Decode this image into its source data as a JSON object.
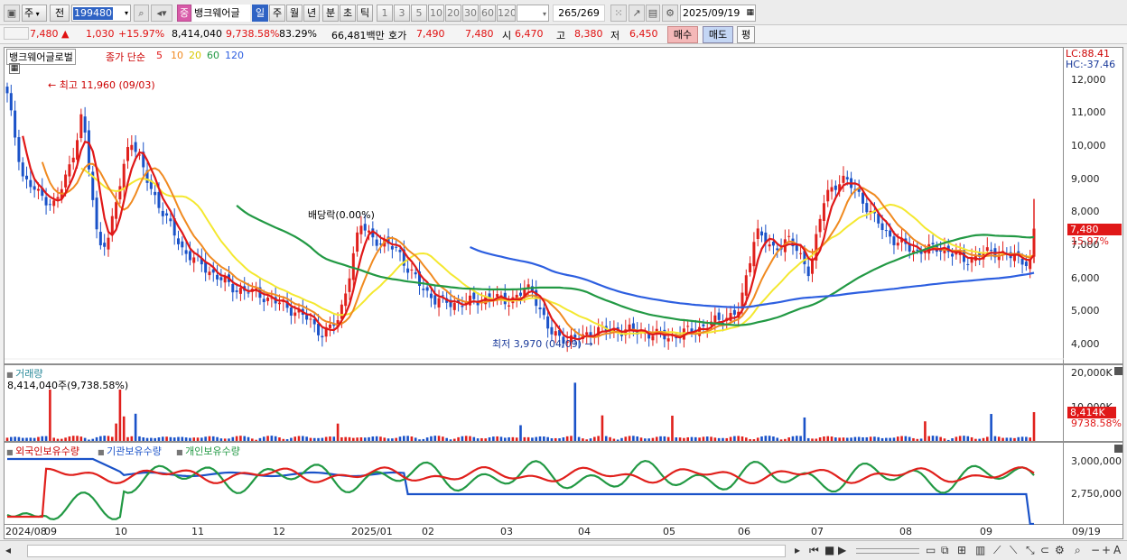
{
  "toolbar": {
    "market": "주",
    "prev": "전",
    "code": "199480",
    "stock_name": "뱅크웨어글",
    "stock_badge": "중",
    "periods": [
      "일",
      "주",
      "월",
      "년",
      "분",
      "초",
      "틱"
    ],
    "active_period": "일",
    "intervals": [
      "1",
      "3",
      "5",
      "10",
      "20",
      "30",
      "60",
      "120"
    ],
    "count": "265",
    "total": "/269",
    "date": "2025/09/19"
  },
  "quote": {
    "price": "7,480",
    "arrow": "▲",
    "change": "1,030",
    "change_pct": "+15.97%",
    "volume": "8,414,040",
    "vol_ratio": "9,738.58%",
    "rate": "83.29%",
    "amount": "66,481백만",
    "ask_label": "호가",
    "ask1": "7,490",
    "ask2": "7,480",
    "open_label": "시",
    "open": "6,470",
    "high_label": "고",
    "high": "8,380",
    "low_label": "저",
    "low": "6,450",
    "buy": "매수",
    "sell": "매도",
    "eval": "평"
  },
  "price_pane": {
    "name": "뱅크웨어글로벌",
    "ma_label": "종가 단순",
    "ma": [
      "5",
      "10",
      "20",
      "60",
      "120"
    ],
    "lc": "LC:88.41",
    "hc": "HC:-37.46",
    "max_label": "최고 11,960 (09/03)",
    "min_label": "최저 3,970 (04/09)",
    "dividend": "배당락(0.00%)",
    "last_price": "7,480",
    "last_pct": "15.97%",
    "y_ticks": [
      "12,000",
      "11,000",
      "10,000",
      "9,000",
      "8,000",
      "7,000",
      "6,000",
      "5,000",
      "4,000"
    ]
  },
  "volume_pane": {
    "title": "거래량",
    "value": "8,414,040주(9,738.58%)",
    "y_ticks": [
      "20,000K",
      "10,000K"
    ],
    "last_value": "8,414K",
    "last_pct": "9738.58%"
  },
  "holding_pane": {
    "series": [
      "외국인보유수량",
      "기관보유수량",
      "개인보유수량"
    ],
    "y_ticks": [
      "3,000,000",
      "2,750,000"
    ]
  },
  "x_ticks": [
    "2024/08",
    "09",
    "10",
    "11",
    "12",
    "2025/01",
    "02",
    "03",
    "04",
    "05",
    "06",
    "07",
    "08",
    "09"
  ],
  "x_end": "09/19",
  "colors": {
    "up": "#e0201c",
    "down": "#1a52c8",
    "ma5": "#e01818",
    "ma10": "#f08a20",
    "ma20": "#f4e830",
    "ma60": "#229944",
    "ma120": "#2d5fe0"
  },
  "chart_data": {
    "type": "candlestick",
    "y_range": [
      3800,
      12300
    ],
    "x": [
      "2024/08",
      "09",
      "10",
      "11",
      "12",
      "2025/01",
      "02",
      "03",
      "04",
      "05",
      "06",
      "07",
      "08",
      "09",
      "09/19"
    ],
    "close_approx": [
      11500,
      8500,
      10200,
      6700,
      4300,
      7300,
      5400,
      5400,
      4050,
      4400,
      4300,
      9000,
      6900,
      6700,
      7480
    ],
    "ma120_approx": [
      7300,
      6000,
      5300,
      5600,
      5700,
      5900,
      5950
    ],
    "volume_max": "20,000K",
    "last_volume": 8414
  }
}
